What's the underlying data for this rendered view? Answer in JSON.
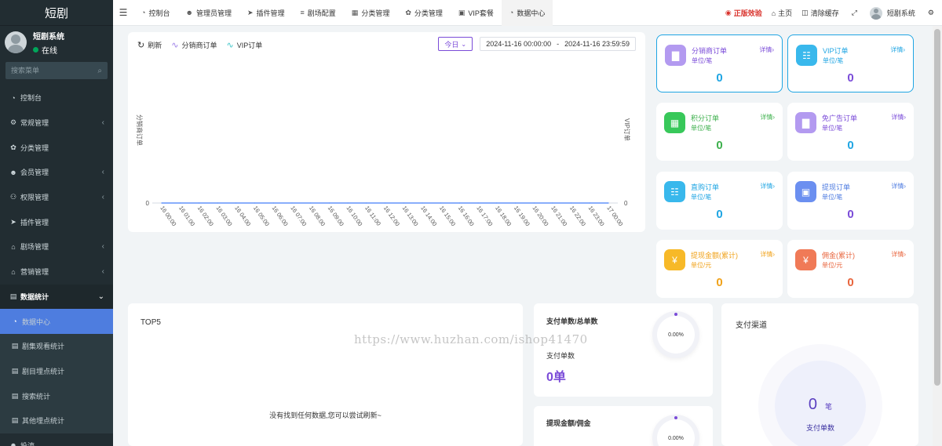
{
  "sidebar": {
    "logo": "短剧",
    "user_name": "短剧系统",
    "status": "在线",
    "search_placeholder": "搜索菜单",
    "items": [
      {
        "label": "控制台",
        "icon": "dashboard-icon"
      },
      {
        "label": "常规管理",
        "icon": "cogs-icon",
        "has_children": true
      },
      {
        "label": "分类管理",
        "icon": "leaf-icon"
      },
      {
        "label": "会员管理",
        "icon": "user-icon",
        "has_children": true
      },
      {
        "label": "权限管理",
        "icon": "users-icon",
        "has_children": true
      },
      {
        "label": "插件管理",
        "icon": "rocket-icon"
      },
      {
        "label": "剧场管理",
        "icon": "home-icon",
        "has_children": true
      },
      {
        "label": "营销管理",
        "icon": "home-icon",
        "has_children": true
      },
      {
        "label": "数据统计",
        "icon": "bar-chart-icon",
        "has_children": true,
        "open": true
      }
    ],
    "sub_items": [
      {
        "label": "数据中心",
        "icon": "dashboard-icon",
        "active": true
      },
      {
        "label": "剧集观看统计",
        "icon": "file-icon"
      },
      {
        "label": "剧目埋点统计",
        "icon": "file-icon"
      },
      {
        "label": "搜索统计",
        "icon": "file-icon"
      },
      {
        "label": "其他埋点统计",
        "icon": "file-icon"
      }
    ],
    "last_item": "投流"
  },
  "topnav": {
    "tabs": [
      {
        "label": "控制台",
        "icon": "dashboard-icon"
      },
      {
        "label": "管理员管理",
        "icon": "user-icon"
      },
      {
        "label": "插件管理",
        "icon": "rocket-icon"
      },
      {
        "label": "剧场配置",
        "icon": "sliders-icon"
      },
      {
        "label": "分类管理",
        "icon": "sitemap-icon"
      },
      {
        "label": "分类管理",
        "icon": "leaf-icon"
      },
      {
        "label": "VIP套餐",
        "icon": "vip-icon"
      },
      {
        "label": "数据中心",
        "icon": "dashboard-icon",
        "active": true
      }
    ],
    "right": {
      "genuine": "正版效验",
      "home": "主页",
      "clear_cache": "清除缓存",
      "user": "短剧系统"
    }
  },
  "chart_panel": {
    "refresh": "刷新",
    "legend": [
      "分销商订单",
      "VIP订单"
    ],
    "today": "今日",
    "date_start": "2024-11-16 00:00:00",
    "date_sep": "-",
    "date_end": "2024-11-16 23:59:59"
  },
  "chart_data": {
    "type": "line",
    "categories": [
      "16 00:00",
      "16 01:00",
      "16 02:00",
      "16 03:00",
      "16 04:00",
      "16 05:00",
      "16 06:00",
      "16 07:00",
      "16 08:00",
      "16 09:00",
      "16 10:00",
      "16 11:00",
      "16 12:00",
      "16 13:00",
      "16 14:00",
      "16 15:00",
      "16 16:00",
      "16 17:00",
      "16 18:00",
      "16 19:00",
      "16 20:00",
      "16 21:00",
      "16 22:00",
      "16 23:00",
      "17 00:00"
    ],
    "series": [
      {
        "name": "分销商订单",
        "values": [
          0,
          0,
          0,
          0,
          0,
          0,
          0,
          0,
          0,
          0,
          0,
          0,
          0,
          0,
          0,
          0,
          0,
          0,
          0,
          0,
          0,
          0,
          0,
          0,
          0
        ]
      },
      {
        "name": "VIP订单",
        "values": [
          0,
          0,
          0,
          0,
          0,
          0,
          0,
          0,
          0,
          0,
          0,
          0,
          0,
          0,
          0,
          0,
          0,
          0,
          0,
          0,
          0,
          0,
          0,
          0,
          0
        ]
      }
    ],
    "ylabel_left": "分销商订单",
    "ylabel_right": "VIP订单",
    "y_tick_left": "0",
    "y_tick_right": "0",
    "colors": {
      "line": "#5b8ff9",
      "legend_a": "#9b7de8",
      "legend_b": "#3ec5c8"
    }
  },
  "stats": [
    {
      "title": "分销商订单",
      "unit": "单位/笔",
      "detail": "详情",
      "value": "0",
      "color": "#7a4bd8",
      "icon_bg": "#b39af0",
      "icon": "bar-chart-icon",
      "value_color": "#1fa5e3",
      "highlight": true
    },
    {
      "title": "VIP订单",
      "unit": "单位/笔",
      "detail": "详情",
      "value": "0",
      "color": "#1fa5e3",
      "icon_bg": "#39b8ec",
      "icon": "file-icon",
      "value_color": "#7a4bd8",
      "highlight": true
    },
    {
      "title": "积分订单",
      "unit": "单位/笔",
      "detail": "详情",
      "value": "0",
      "color": "#3db04c",
      "icon_bg": "#38c85a",
      "icon": "calendar-icon",
      "value_color": "#3db04c"
    },
    {
      "title": "免广告订单",
      "unit": "单位/笔",
      "detail": "详情",
      "value": "0",
      "color": "#7a4bd8",
      "icon_bg": "#b39af0",
      "icon": "bar-chart-icon",
      "value_color": "#1fa5e3"
    },
    {
      "title": "直购订单",
      "unit": "单位/笔",
      "detail": "详情",
      "value": "0",
      "color": "#1fa5e3",
      "icon_bg": "#39b8ec",
      "icon": "file-icon",
      "value_color": "#1fa5e3"
    },
    {
      "title": "提现订单",
      "unit": "单位/笔",
      "detail": "详情",
      "value": "0",
      "color": "#4d7be0",
      "icon_bg": "#6b8ff0",
      "icon": "wallet-icon",
      "value_color": "#7a4bd8"
    },
    {
      "title": "提现金额(累计)",
      "unit": "单位/元",
      "detail": "详情",
      "value": "0",
      "color": "#f0a21a",
      "icon_bg": "#f7b928",
      "icon": "shield-yen-icon",
      "value_color": "#f0a21a"
    },
    {
      "title": "佣金(累计)",
      "unit": "单位/元",
      "detail": "详情",
      "value": "0",
      "color": "#e8643c",
      "icon_bg": "#f07a57",
      "icon": "yen-badge-icon",
      "value_color": "#e8643c"
    }
  ],
  "top5": {
    "title": "TOP5",
    "empty": "没有找到任何数据,您可以尝试刷新~"
  },
  "pay_card": {
    "title": "支付单数/总单数",
    "sub": "支付单数",
    "value": "0单",
    "percent": "0.00%"
  },
  "withdraw_card": {
    "title": "提现金额/佣金",
    "percent": "0.00%"
  },
  "channel": {
    "title": "支付渠道",
    "value": "0",
    "unit": "笔",
    "label": "支付单数"
  },
  "watermark": "https://www.huzhan.com/ishop41470"
}
